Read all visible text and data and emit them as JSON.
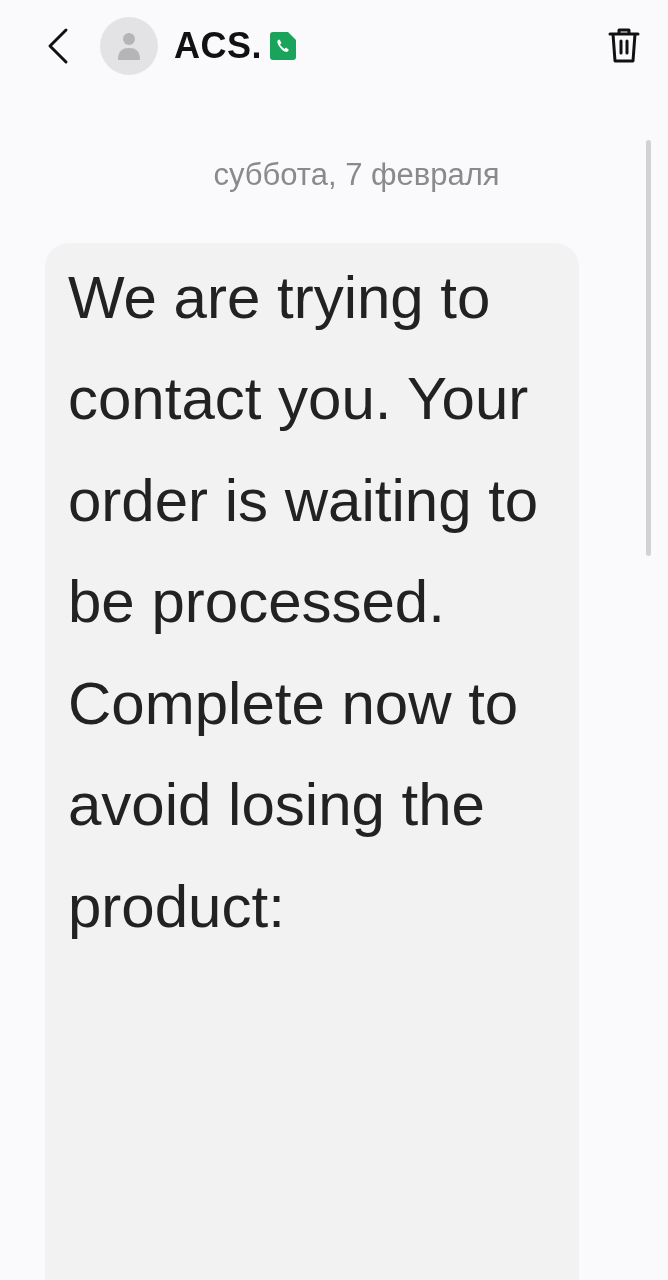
{
  "header": {
    "contact_name": "ACS.",
    "verified": true
  },
  "conversation": {
    "date": "суббота, 7 февраля",
    "messages": [
      {
        "text": "We are trying to contact you. Your order is waiting to be processed. Complete now to avoid losing the product:",
        "incoming": true
      }
    ]
  }
}
